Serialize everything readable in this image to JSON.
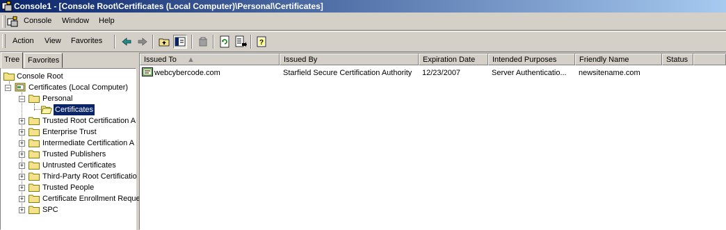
{
  "window": {
    "title": "Console1 - [Console Root\\Certificates (Local Computer)\\Personal\\Certificates]"
  },
  "menubar": {
    "console": "Console",
    "window": "Window",
    "help": "Help"
  },
  "actionbar": {
    "action": "Action",
    "view": "View",
    "favorites": "Favorites"
  },
  "tabs": {
    "tree": "Tree",
    "favorites": "Favorites"
  },
  "tree": {
    "root": "Console Root",
    "certificates": "Certificates (Local Computer)",
    "personal": "Personal",
    "personal_certificates": "Certificates",
    "trusted_root": "Trusted Root Certification A",
    "enterprise_trust": "Enterprise Trust",
    "intermediate": "Intermediate Certification A",
    "trusted_publishers": "Trusted Publishers",
    "untrusted": "Untrusted Certificates",
    "third_party": "Third-Party Root Certificatio",
    "trusted_people": "Trusted People",
    "enrollment": "Certificate Enrollment Reque",
    "spc": "SPC"
  },
  "list": {
    "columns": {
      "issued_to": "Issued To",
      "issued_by": "Issued By",
      "expiration": "Expiration Date",
      "purposes": "Intended Purposes",
      "friendly": "Friendly Name",
      "status": "Status"
    },
    "rows": [
      {
        "issued_to": "webcybercode.com",
        "issued_by": "Starfield Secure Certification Authority",
        "expiration": "12/23/2007",
        "purposes": "Server Authenticatio...",
        "friendly": "newsitename.com",
        "status": ""
      }
    ]
  },
  "colors": {
    "title_start": "#0a246a",
    "title_end": "#a6caf0",
    "selection": "#0a246a",
    "folder": "#f5e18c"
  }
}
